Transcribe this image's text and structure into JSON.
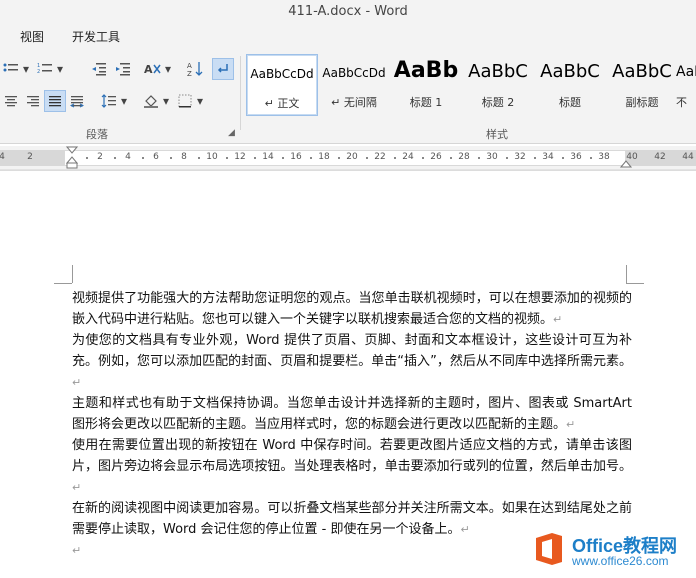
{
  "window": {
    "title": "411-A.docx - Word"
  },
  "tabs": [
    {
      "label": "视图"
    },
    {
      "label": "开发工具"
    }
  ],
  "ribbon": {
    "paragraph_group_label": "段落",
    "styles_group_label": "样式",
    "styles": [
      {
        "sample": "AaBbCcDd",
        "name": "↵ 正文"
      },
      {
        "sample": "AaBbCcDd",
        "name": "↵ 无间隔"
      },
      {
        "sample": "AaBb",
        "name": "标题 1"
      },
      {
        "sample": "AaBbC",
        "name": "标题 2"
      },
      {
        "sample": "AaBbC",
        "name": "标题"
      },
      {
        "sample": "AaBbC",
        "name": "副标题"
      },
      {
        "sample": "AaB",
        "name": "不"
      }
    ]
  },
  "ruler": {
    "left_labels": [
      "4",
      "2"
    ],
    "labels": [
      "2",
      "4",
      "6",
      "8",
      "10",
      "12",
      "14",
      "16",
      "18",
      "20",
      "22",
      "24",
      "26",
      "28",
      "30",
      "32",
      "34",
      "36",
      "38"
    ],
    "right_labels": [
      "40",
      "42",
      "44"
    ]
  },
  "document": {
    "paragraphs": [
      "视频提供了功能强大的方法帮助您证明您的观点。当您单击联机视频时，可以在想要添加的视频的嵌入代码中进行粘贴。您也可以键入一个关键字以联机搜索最适合您的文档的视频。",
      "为使您的文档具有专业外观，Word 提供了页眉、页脚、封面和文本框设计，这些设计可互为补充。例如，您可以添加匹配的封面、页眉和提要栏。单击“插入”，然后从不同库中选择所需元素。",
      "主题和样式也有助于文档保持协调。当您单击设计并选择新的主题时，图片、图表或 SmartArt 图形将会更改以匹配新的主题。当应用样式时，您的标题会进行更改以匹配新的主题。",
      "使用在需要位置出现的新按钮在 Word 中保存时间。若要更改图片适应文档的方式，请单击该图片，图片旁边将会显示布局选项按钮。当处理表格时，单击要添加行或列的位置，然后单击加号。",
      "在新的阅读视图中阅读更加容易。可以折叠文档某些部分并关注所需文本。如果在达到结尾处之前需要停止读取，Word 会记住您的停止位置 - 即使在另一个设备上。",
      ""
    ],
    "paragraph_mark": "↵"
  },
  "watermark": {
    "brand": "Office教程网",
    "site": "www.office26.com"
  }
}
